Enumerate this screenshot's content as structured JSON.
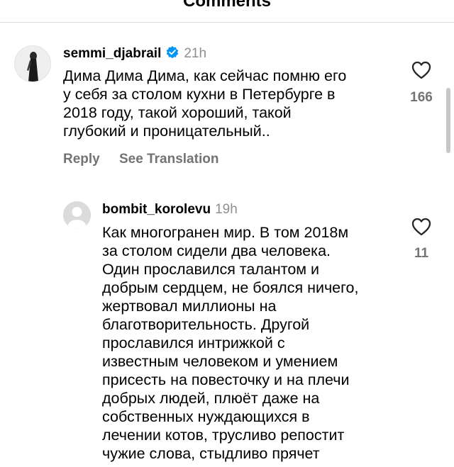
{
  "header": {
    "title": "Comments"
  },
  "comments": [
    {
      "username": "semmi_djabrail",
      "verified": true,
      "time": "21h",
      "lines": [
        "Дима Дима Дима, как сейчас помню его",
        "у себя за столом кухни в Петербурге в",
        "2018 году, такой хороший, такой",
        "глубокий и проницательный.."
      ],
      "likes": "166",
      "reply_label": "Reply",
      "translate_label": "See Translation"
    },
    {
      "username": "bombit_korolevu",
      "verified": false,
      "time": "19h",
      "lines": [
        "Как многогранен мир. В том 2018м",
        "за столом сидели два человека.",
        "Один прославился талантом и",
        "добрым сердцем, не боялся ничего,",
        "жертвовал миллионы на",
        "благотворительность. Другой",
        "прославился интрижкой с",
        "известным человеком и умением",
        "присесть на повесточку и на плечи",
        "добрых людей, плюёт даже на",
        "собственных нуждающихся в",
        "лечении котов, трусливо репостит",
        "чужие слова, стыдливо прячет"
      ],
      "likes": "11"
    }
  ],
  "icons": {
    "like": "heart-outline-icon",
    "verified": "verified-badge-icon",
    "avatar_default": "default-avatar-icon"
  },
  "colors": {
    "text": "#000000",
    "secondary": "#737373",
    "timestamp": "#8e8e8e",
    "verified": "#0095f6",
    "divider": "#dbdbdb"
  }
}
